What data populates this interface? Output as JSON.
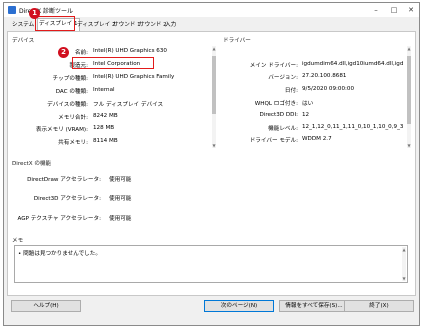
{
  "window": {
    "title": "DirectX 診断ツール"
  },
  "tabs": [
    "システム",
    "ディスプレイ 1",
    "ディスプレイ 2",
    "サウンド 1",
    "サウンド 2",
    "入力"
  ],
  "device": {
    "heading": "デバイス",
    "rows": [
      {
        "label": "名前:",
        "value": "Intel(R) UHD Graphics 630"
      },
      {
        "label": "製造元:",
        "value": "Intel Corporation"
      },
      {
        "label": "チップの種類:",
        "value": "Intel(R) UHD Graphics Family"
      },
      {
        "label": "DAC の種類:",
        "value": "Internal"
      },
      {
        "label": "デバイスの種類:",
        "value": "フル ディスプレイ デバイス"
      },
      {
        "label": "メモリ合計:",
        "value": "8242 MB"
      },
      {
        "label": "表示メモリ (VRAM):",
        "value": "128 MB"
      },
      {
        "label": "共有メモリ:",
        "value": "8114 MB"
      }
    ]
  },
  "driver": {
    "heading": "ドライバー",
    "rows": [
      {
        "label": "メイン ドライバー:",
        "value": "igdumdim64.dll,igd10iumd64.dll,igd"
      },
      {
        "label": "バージョン:",
        "value": "27.20.100.8681"
      },
      {
        "label": "日付:",
        "value": "9/5/2020 09:00:00"
      },
      {
        "label": "WHQL ロゴ付き:",
        "value": "はい"
      },
      {
        "label": "Direct3D DDI:",
        "value": "12"
      },
      {
        "label": "機能レベル:",
        "value": "12_1,12_0,11_1,11_0,10_1,10_0,9_3,9_2"
      },
      {
        "label": "ドライバー モデル:",
        "value": "WDDM 2.7"
      }
    ]
  },
  "features": {
    "heading": "DirectX の機能",
    "rows": [
      {
        "label": "DirectDraw アクセラレータ:",
        "value": "使用可能"
      },
      {
        "label": "Direct3D アクセラレータ:",
        "value": "使用可能"
      },
      {
        "label": "AGP テクスチャ アクセラレータ:",
        "value": "使用可能"
      }
    ]
  },
  "memo": {
    "heading": "メモ",
    "items": [
      "問題は見つかりませんでした。"
    ]
  },
  "buttons": {
    "help": "ヘルプ(H)",
    "next": "次のページ(N)",
    "save": "情報をすべて保存(S)...",
    "exit": "終了(X)"
  },
  "annotations": {
    "badge1": "1",
    "badge2": "2"
  },
  "colors": {
    "highlight": "#e21a1a",
    "badge": "#d10f1f"
  }
}
